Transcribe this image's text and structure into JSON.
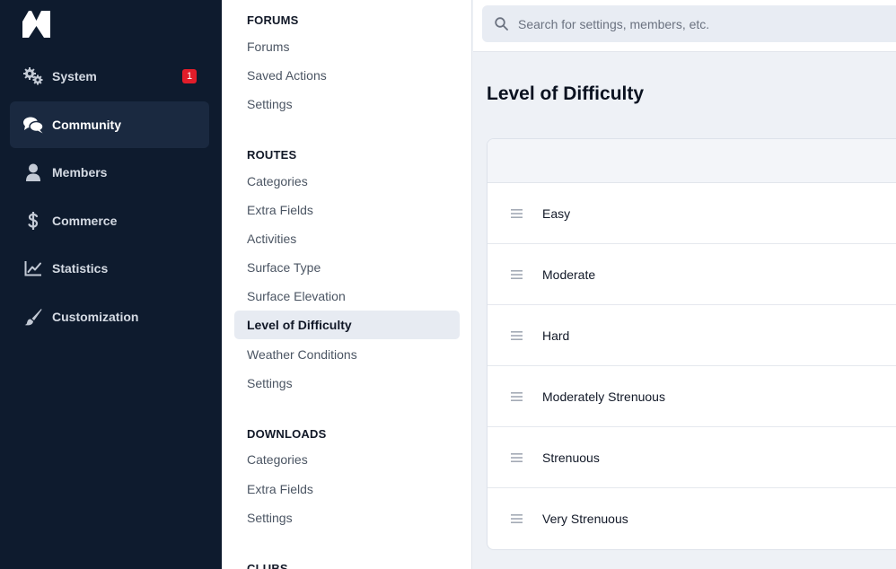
{
  "primary_nav": {
    "items": [
      {
        "label": "System",
        "icon": "gears-icon",
        "badge": "1"
      },
      {
        "label": "Community",
        "icon": "chat-bubbles-icon",
        "active": true
      },
      {
        "label": "Members",
        "icon": "person-icon"
      },
      {
        "label": "Commerce",
        "icon": "dollar-icon"
      },
      {
        "label": "Statistics",
        "icon": "line-chart-icon"
      },
      {
        "label": "Customization",
        "icon": "paintbrush-icon"
      }
    ]
  },
  "secondary_nav": {
    "sections": [
      {
        "heading": "FORUMS",
        "links": [
          "Forums",
          "Saved Actions",
          "Settings"
        ]
      },
      {
        "heading": "ROUTES",
        "links": [
          "Categories",
          "Extra Fields",
          "Activities",
          "Surface Type",
          "Surface Elevation",
          "Level of Difficulty",
          "Weather Conditions",
          "Settings"
        ],
        "active_link": "Level of Difficulty"
      },
      {
        "heading": "DOWNLOADS",
        "links": [
          "Categories",
          "Extra Fields",
          "Settings"
        ]
      },
      {
        "heading": "CLUBS",
        "links": []
      }
    ]
  },
  "search": {
    "placeholder": "Search for settings, members, etc."
  },
  "main": {
    "title": "Level of Difficulty",
    "rows": [
      "Easy",
      "Moderate",
      "Hard",
      "Moderately Strenuous",
      "Strenuous",
      "Very Strenuous"
    ]
  },
  "colors": {
    "sidebar_bg": "#0e1b2e",
    "sidebar_active": "#1a2940",
    "badge": "#e11d2a",
    "active_link_bg": "#e7ebf2"
  }
}
